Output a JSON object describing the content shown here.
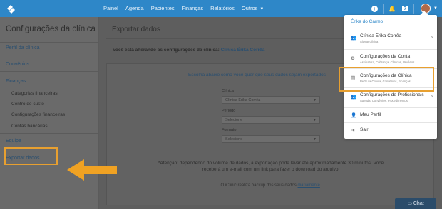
{
  "nav": {
    "items": [
      "Painel",
      "Agenda",
      "Pacientes",
      "Finanças",
      "Relatórios",
      "Outros"
    ]
  },
  "sidebar": {
    "title": "Configurações da clínica",
    "sections": {
      "perfil": "Perfil da clínica",
      "convenios": "Convênios",
      "financas": "Finanças",
      "financas_items": [
        "Categorias financeiras",
        "Centro de custo",
        "Configurações financeiras",
        "Contas bancárias"
      ],
      "equipe": "Equipe",
      "exportar": "Exportar dados"
    }
  },
  "main": {
    "title": "Exportar dados",
    "clinic_prefix": "Você está alterando as configurações da clínica:",
    "clinic_name": "Clínica Érika Corrêa",
    "question": "Escolha abaixo como você quer que seus dados sejam exportados",
    "fields": {
      "clinica_label": "Clínica",
      "clinica_value": "Clínica Érika Corrêa",
      "periodo_label": "Período",
      "periodo_value": "Selecione",
      "formato_label": "Formato",
      "formato_value": "Selecione"
    },
    "note": "*Atenção: dependendo do volume de dados, a exportação pode levar até aproximadamente 30 minutos. Você receberá um e-mail com um link para fazer o download do arquivo.",
    "backup_prefix": "O iClinic realiza backup dos seus dados",
    "backup_link": "diariamente",
    "backup_suffix": "."
  },
  "dropdown": {
    "user_name": "Érika do Carmo",
    "items": [
      {
        "title": "Clínica Érika Corrêa",
        "subtitle": "Alterar clínica",
        "icon": "people-icon",
        "has_arrow": true
      },
      {
        "title": "Configurações da Conta",
        "subtitle": "Assinatura, Cobrança, Clínicas, Usuários",
        "icon": "gear-icon",
        "has_arrow": false
      },
      {
        "title": "Configurações da Clínica",
        "subtitle": "Perfil da Clínica, Convênios, Finanças",
        "icon": "clipboard-icon",
        "has_arrow": false
      },
      {
        "title": "Configurações de Profissionais",
        "subtitle": "Agenda, Convênios, Procedimentos",
        "icon": "users-icon",
        "has_arrow": true
      },
      {
        "title": "Meu Perfil",
        "subtitle": "",
        "icon": "user-icon",
        "has_arrow": false
      },
      {
        "title": "Sair",
        "subtitle": "",
        "icon": "logout-icon",
        "has_arrow": false
      }
    ]
  },
  "chat": {
    "label": "Chat"
  },
  "colors": {
    "brand": "#2e87c8",
    "highlight": "#e8a030"
  }
}
